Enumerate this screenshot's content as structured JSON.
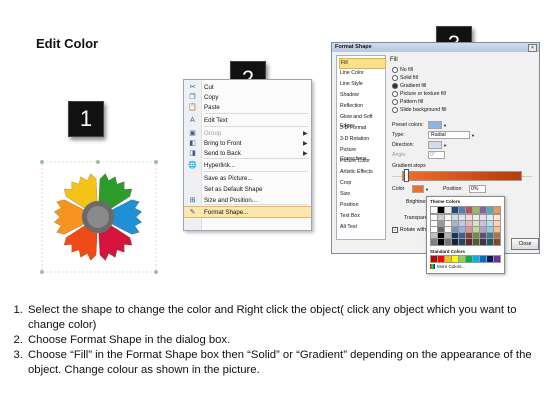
{
  "title": "Edit Color",
  "steps": [
    "1",
    "2",
    "3"
  ],
  "context_menu": {
    "items": [
      {
        "label": "Cut",
        "icon": "scissors-icon",
        "glyph": "✂",
        "disabled": false,
        "submenu": false
      },
      {
        "label": "Copy",
        "icon": "copy-icon",
        "glyph": "❐",
        "disabled": false,
        "submenu": false
      },
      {
        "label": "Paste",
        "icon": "paste-icon",
        "glyph": "📋",
        "disabled": false,
        "submenu": false
      },
      {
        "label": "Edit Text",
        "icon": "edit-text-icon",
        "glyph": "A",
        "disabled": false,
        "submenu": false
      },
      {
        "label": "Group",
        "icon": "group-icon",
        "glyph": "▣",
        "disabled": true,
        "submenu": true
      },
      {
        "label": "Bring to Front",
        "icon": "bring-front-icon",
        "glyph": "◧",
        "disabled": false,
        "submenu": true
      },
      {
        "label": "Send to Back",
        "icon": "send-back-icon",
        "glyph": "◨",
        "disabled": false,
        "submenu": true
      },
      {
        "label": "Hyperlink...",
        "icon": "hyperlink-icon",
        "glyph": "🌐",
        "disabled": false,
        "submenu": false
      },
      {
        "label": "Save as Picture...",
        "icon": "",
        "glyph": "",
        "disabled": false,
        "submenu": false
      },
      {
        "label": "Set as Default Shape",
        "icon": "",
        "glyph": "",
        "disabled": false,
        "submenu": false
      },
      {
        "label": "Size and Position...",
        "icon": "size-position-icon",
        "glyph": "⊞",
        "disabled": false,
        "submenu": false
      },
      {
        "label": "Format Shape...",
        "icon": "format-shape-icon",
        "glyph": "✎",
        "disabled": false,
        "submenu": false,
        "highlight": true
      }
    ]
  },
  "format_dialog": {
    "title": "Format Shape",
    "nav": [
      "Fill",
      "Line Color",
      "Line Style",
      "Shadow",
      "Reflection",
      "Glow and Soft Edges",
      "3-D Format",
      "3-D Rotation",
      "Picture Corrections",
      "Picture Color",
      "Artistic Effects",
      "Crop",
      "Size",
      "Position",
      "Text Box",
      "Alt Text"
    ],
    "section": "Fill",
    "fill_options": [
      "No fill",
      "Solid fill",
      "Gradient fill",
      "Picture or texture fill",
      "Pattern fill",
      "Slide background fill"
    ],
    "selected_fill": "Gradient fill",
    "preset_label": "Preset colors:",
    "type_label": "Type:",
    "type_value": "Radial",
    "direction_label": "Direction:",
    "angle_label": "Angle:",
    "angle_value": "0°",
    "stops_label": "Gradient stops",
    "color_label": "Color",
    "position_label": "Position:",
    "position_value": "0%",
    "brightness_label": "Brightness:",
    "transparency_label": "Transparency:",
    "rotate_label": "Rotate with shape",
    "close_label": "Close"
  },
  "palette": {
    "theme_label": "Theme Colors",
    "standard_label": "Standard Colors",
    "more_label": "More Colors...",
    "theme_top": [
      "#ffffff",
      "#000000",
      "#eeece1",
      "#1f497d",
      "#4f81bd",
      "#c0504d",
      "#9bbb59",
      "#8064a2",
      "#4bacc6",
      "#f79646"
    ],
    "standard": [
      "#c00000",
      "#ff0000",
      "#ffc000",
      "#ffff00",
      "#92d050",
      "#00b050",
      "#00b0f0",
      "#0070c0",
      "#002060",
      "#7030a0"
    ]
  },
  "instructions": [
    "Select the shape to change the color and Right click the object( click any object which you want to change color)",
    "Choose Format Shape in the dialog box.",
    "Choose “Fill” in the Format Shape box then “Solid” or “Gradient” depending on the appearance of the object. Change colour as shown in the picture."
  ],
  "gear_colors": [
    "#2e9c2a",
    "#1f8fd6",
    "#d4143c",
    "#f04b16",
    "#f7941d",
    "#f5c318"
  ]
}
